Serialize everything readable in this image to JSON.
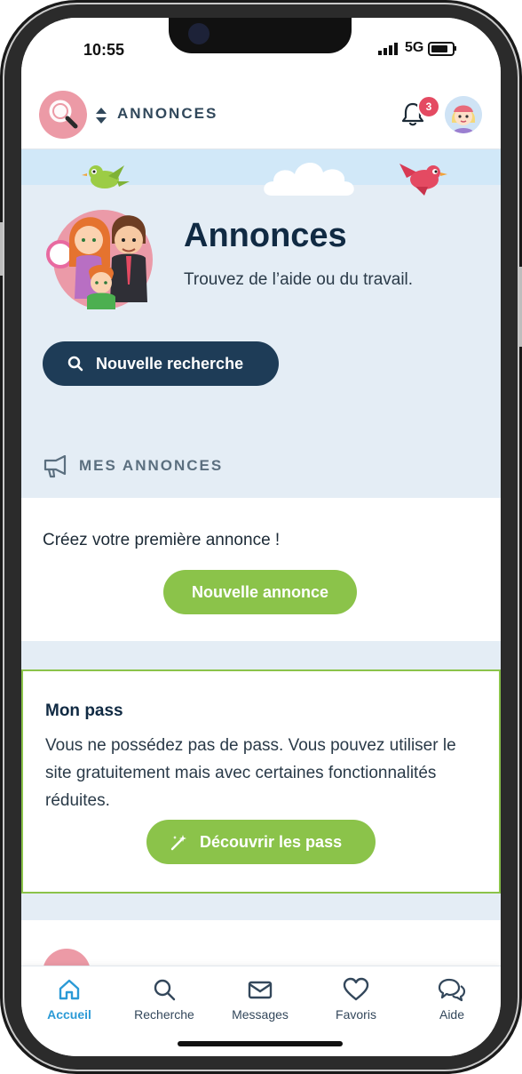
{
  "status_bar": {
    "time": "10:55",
    "network": "5G"
  },
  "header": {
    "title": "ANNONCES",
    "notification_count": "3"
  },
  "hero": {
    "title": "Annonces",
    "subtitle": "Trouvez de l’aide ou du travail.",
    "search_button": "Nouvelle recherche"
  },
  "my_ads": {
    "section_title": "MES ANNONCES",
    "empty_text": "Créez votre première annonce !",
    "new_ad_button": "Nouvelle annonce"
  },
  "pass": {
    "title": "Mon pass",
    "body": "Vous ne possédez pas de pass. Vous pouvez utiliser le site gratuitement mais avec certaines fonctionnalités réduites.",
    "button": "Découvrir les pass"
  },
  "bottom_nav": {
    "items": [
      {
        "label": "Accueil",
        "icon": "home-icon",
        "active": true
      },
      {
        "label": "Recherche",
        "icon": "search-icon",
        "active": false
      },
      {
        "label": "Messages",
        "icon": "mail-icon",
        "active": false
      },
      {
        "label": "Favoris",
        "icon": "heart-icon",
        "active": false
      },
      {
        "label": "Aide",
        "icon": "chat-bubbles-icon",
        "active": false
      }
    ]
  },
  "colors": {
    "accent_green": "#8bc34a",
    "navy": "#1e3c57",
    "active_blue": "#2b9ad6",
    "badge_red": "#e44a62",
    "logo_pink": "#ec9aa6",
    "page_bg": "#e4edf5"
  }
}
